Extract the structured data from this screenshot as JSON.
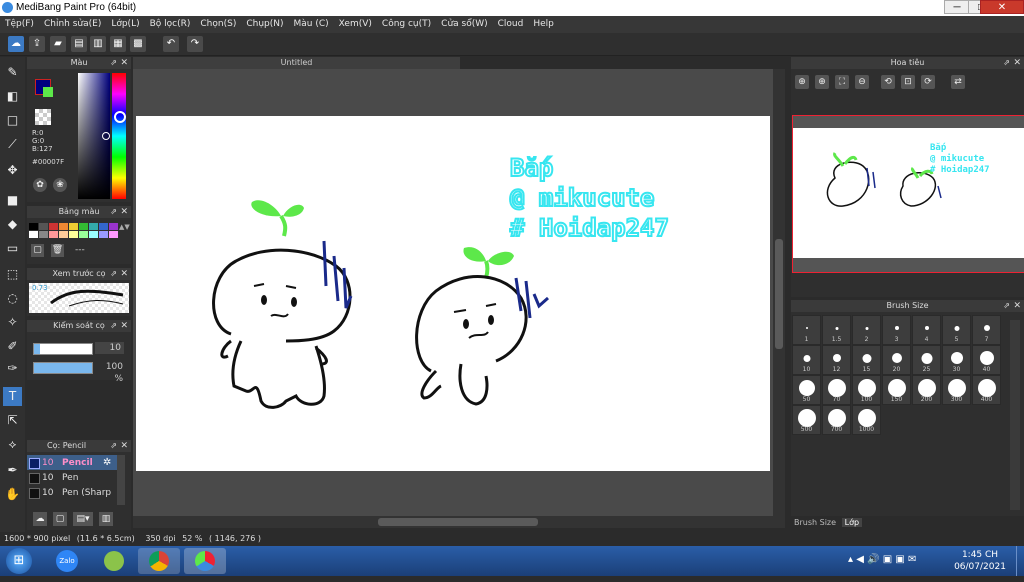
{
  "app": {
    "title": "MediBang Paint Pro (64bit)"
  },
  "window_controls": {
    "minimize": "─",
    "maximize": "□",
    "close": "✕"
  },
  "menu": [
    "Tệp(F)",
    "Chỉnh sửa(E)",
    "Lớp(L)",
    "Bộ lọc(R)",
    "Chọn(S)",
    "Chụp(N)",
    "Màu (C)",
    "Xem(V)",
    "Công cụ(T)",
    "Cửa sổ(W)",
    "Cloud",
    "Help"
  ],
  "document": {
    "tab_title": "Untitled"
  },
  "canvas_text": {
    "line1": "Bắp",
    "line2": "@ mikucute",
    "line3": "# Hoidap247",
    "color": "#37e6f0"
  },
  "color_panel": {
    "title": "Màu",
    "r": "R:0",
    "g": "G:0",
    "b": "B:127",
    "hex": "#00007F"
  },
  "palette_panel": {
    "title": "Bảng màu",
    "dash": "---"
  },
  "preview_panel": {
    "title": "Xem trước cọ",
    "size": "0.73"
  },
  "control_panel": {
    "title": "Kiểm soát cọ",
    "size_value": "10",
    "opacity_value": "100 %",
    "opacity": 100
  },
  "brush_list_panel": {
    "title": "Cọ: Pencil",
    "items": [
      {
        "size": "10",
        "name": "Pencil"
      },
      {
        "size": "10",
        "name": "Pen"
      },
      {
        "size": "10",
        "name": "Pen (Sharp"
      }
    ]
  },
  "navigator_panel": {
    "title": "Hoa tiêu"
  },
  "brush_size_panel": {
    "title": "Brush Size",
    "sizes": [
      "1",
      "1.5",
      "2",
      "3",
      "4",
      "5",
      "7",
      "10",
      "12",
      "15",
      "20",
      "25",
      "30",
      "40",
      "50",
      "70",
      "100",
      "150",
      "200",
      "300",
      "400",
      "500",
      "700",
      "1000"
    ],
    "tabs": [
      "Brush Size",
      "Lớp"
    ]
  },
  "status": {
    "pixels": "1600 * 900 pixel",
    "cm": "(11.6 * 6.5cm)",
    "dpi": "350 dpi",
    "zoom": "52 %",
    "coords": "( 1146, 276 )"
  },
  "taskbar": {
    "zalo": "Zalo",
    "time": "1:45 CH",
    "date": "06/07/2021"
  },
  "colors": {
    "accent": "#3c7ac4",
    "sprout": "#5de84a",
    "ink": "#1a1a1a",
    "rain": "#1a2a8a"
  }
}
